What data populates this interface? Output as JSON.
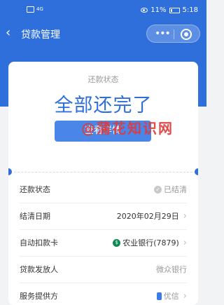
{
  "status_bar": {
    "signal": "4G",
    "battery": "11%",
    "time": "5:18"
  },
  "header": {
    "back_icon": "‹",
    "title": "贷款管理",
    "more_icon": "•••",
    "target_icon": "record-icon"
  },
  "card": {
    "label": "还款状态",
    "status": "全部还完了",
    "detail_button": "查看详情"
  },
  "rows": [
    {
      "label": "还款状态",
      "value": "已结清"
    },
    {
      "label": "结清日期",
      "value": "2020年02月29日"
    },
    {
      "label": "自动扣款卡",
      "value": "农业银行(7879)"
    },
    {
      "label": "贷款发放人",
      "value": "微众银行"
    },
    {
      "label": "服务提供方",
      "value": "优信"
    }
  ],
  "watermark": "@蒲花知识网",
  "colors": {
    "primary": "#2f6fdc",
    "button": "#4a86e8",
    "watermark": "#e03b3b"
  }
}
